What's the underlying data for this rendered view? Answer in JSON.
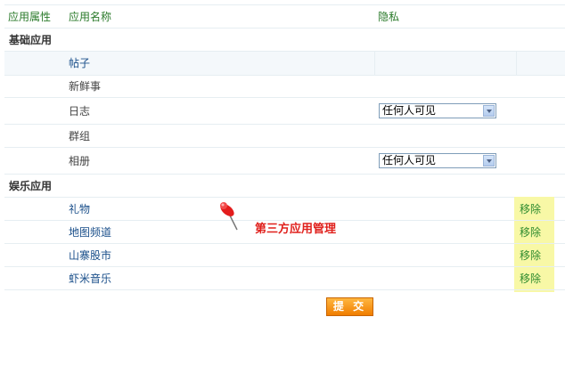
{
  "table_header": {
    "col_attribute": "应用属性",
    "col_name": "应用名称",
    "col_privacy": "隐私"
  },
  "groups": {
    "basic": "基础应用",
    "entertainment": "娱乐应用"
  },
  "basic_apps": [
    {
      "name": "帖子"
    },
    {
      "name": "新鲜事"
    },
    {
      "name": "日志",
      "privacy": "任何人可见"
    },
    {
      "name": "群组"
    },
    {
      "name": "相册",
      "privacy": "任何人可见"
    }
  ],
  "entertainment_apps": [
    {
      "name": "礼物",
      "action": "移除"
    },
    {
      "name": "地图频道",
      "action": "移除"
    },
    {
      "name": "山寨股市",
      "action": "移除"
    },
    {
      "name": "虾米音乐",
      "action": "移除"
    }
  ],
  "annotation": "第三方应用管理",
  "submit_label": "提 交",
  "colors": {
    "header_text": "#2a7a2a",
    "link_text": "#1a4f8a",
    "remove_text": "#2f8c2f",
    "highlight": "#f8f8a6",
    "annotation_text": "#e0201c",
    "submit_bg": "#f59a1c"
  },
  "icons": {
    "pin": "pushpin-icon",
    "dropdown": "chevron-down-icon"
  }
}
